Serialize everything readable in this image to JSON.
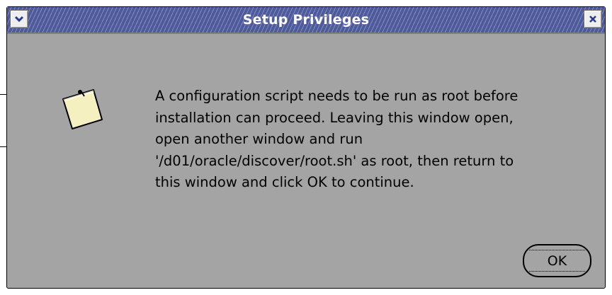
{
  "window": {
    "title": "Setup Privileges",
    "menu_icon": "chevron-down-icon",
    "close_icon": "close-icon"
  },
  "message": {
    "icon": "note-icon",
    "lines": [
      "A configuration script needs to be run as root before",
      "installation can proceed. Leaving this window open,",
      "open another window and run",
      "'/d01/oracle/discover/root.sh' as root, then return to",
      "this window and click OK to continue."
    ]
  },
  "buttons": {
    "ok_label": "OK"
  },
  "colors": {
    "titlebar": "#4f5a9a",
    "dialog_background": "#a4a4a4",
    "note": "#f5f0c0"
  }
}
